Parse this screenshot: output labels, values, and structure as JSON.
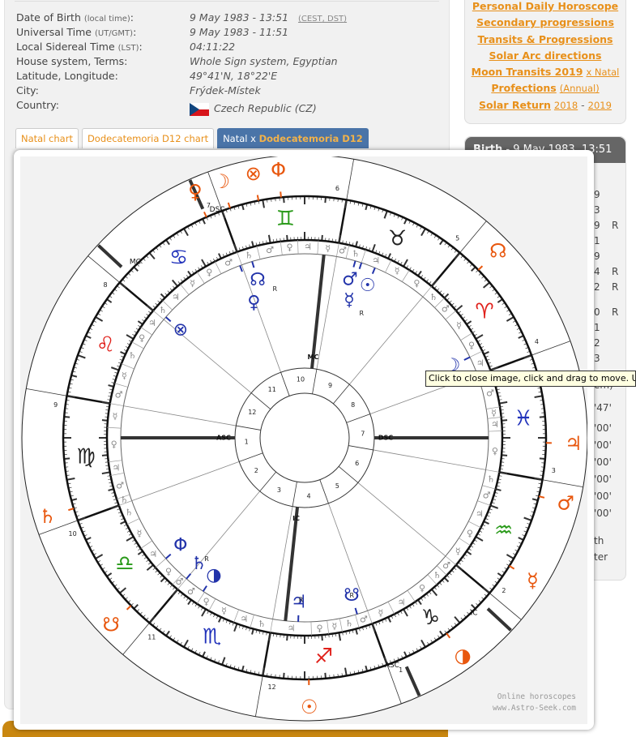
{
  "info": {
    "rows": [
      {
        "label": "Date of Birth",
        "note": "(local time)",
        "value": "9 May 1983 - 13:51",
        "links": [
          "CEST",
          "DST"
        ]
      },
      {
        "label": "Universal Time",
        "note": "(UT/GMT)",
        "value": "9 May 1983 - 11:51"
      },
      {
        "label": "Local Sidereal Time",
        "note": "(LST)",
        "value": "04:11:22"
      },
      {
        "label": "House system, Terms:",
        "value": "Whole Sign system, Egyptian"
      },
      {
        "label": "Latitude, Longitude:",
        "value": "49°41'N, 18°22'E"
      },
      {
        "label": "City:",
        "value": "Frýdek-Místek"
      },
      {
        "label": "Country:",
        "value": "Czech Republic (CZ)"
      }
    ]
  },
  "tabs": {
    "natal": "Natal chart",
    "d12": "Dodecatemoria D12 chart",
    "combo_a": "Natal x ",
    "combo_b": "Dodecatemoria D12"
  },
  "links": {
    "daily": "Personal Daily Horoscope",
    "secondary": "Secondary progressions",
    "transits": "Transits & Progressions",
    "solar_arc": "Solar Arc directions",
    "moon": "Moon Transits 2019",
    "moon_sub": "x Natal",
    "profections": "Profections",
    "profections_sub": "(Annual)",
    "solar_return": "Solar Return",
    "sr1": "2018",
    "sr_sep": "-",
    "sr2": "2019"
  },
  "birth_panel": {
    "header_bold": "Birth",
    "header_rest": " - 9 May 1983, 13:51",
    "fragments": [
      "9",
      "3",
      "9",
      "1",
      "9",
      "4",
      "2",
      "0",
      "1",
      "2",
      "3",
      "em)",
      "'47'",
      "'00'",
      "'00'",
      "'00'",
      "'00'",
      "'00'",
      "'00'",
      "th",
      "ter"
    ],
    "retro_marks": [
      "R",
      "R",
      "R",
      "R"
    ]
  },
  "tooltip": "Click to close image, click and drag to move. Use arrows",
  "credit": {
    "line1": "Online horoscopes",
    "line2": "www.Astro-Seek.com"
  },
  "chart_data": {
    "type": "astrology-biwheel",
    "inner": "Natal",
    "outer": "Dodecatemoria D12",
    "house_system": "Whole Sign",
    "terms": "Egyptian",
    "colors": {
      "fire": "#e0201a",
      "earth": "#222222",
      "air": "#2a9a1a",
      "water": "#2233bb",
      "natal": "#2233aa",
      "d12": "#e8570e"
    },
    "signs": [
      {
        "glyph": "♈",
        "el": "fire"
      },
      {
        "glyph": "♉",
        "el": "earth"
      },
      {
        "glyph": "♊",
        "el": "air"
      },
      {
        "glyph": "♋",
        "el": "water"
      },
      {
        "glyph": "♌",
        "el": "fire"
      },
      {
        "glyph": "♍",
        "el": "earth"
      },
      {
        "glyph": "♎",
        "el": "air"
      },
      {
        "glyph": "♏",
        "el": "water"
      },
      {
        "glyph": "♐",
        "el": "fire"
      },
      {
        "glyph": "♑",
        "el": "earth"
      },
      {
        "glyph": "♒",
        "el": "air"
      },
      {
        "glyph": "♓",
        "el": "water"
      }
    ],
    "egyptian_terms": [
      [
        [
          "♃",
          6
        ],
        [
          "♀",
          6
        ],
        [
          "☿",
          8
        ],
        [
          "♂",
          5
        ],
        [
          "♄",
          5
        ]
      ],
      [
        [
          "♀",
          8
        ],
        [
          "☿",
          6
        ],
        [
          "♃",
          8
        ],
        [
          "♄",
          5
        ],
        [
          "♂",
          3
        ]
      ],
      [
        [
          "☿",
          6
        ],
        [
          "♃",
          6
        ],
        [
          "♀",
          5
        ],
        [
          "♂",
          7
        ],
        [
          "♄",
          6
        ]
      ],
      [
        [
          "♂",
          7
        ],
        [
          "♀",
          6
        ],
        [
          "☿",
          6
        ],
        [
          "♃",
          7
        ],
        [
          "♄",
          4
        ]
      ],
      [
        [
          "♃",
          6
        ],
        [
          "♀",
          5
        ],
        [
          "♄",
          7
        ],
        [
          "☿",
          6
        ],
        [
          "♂",
          6
        ]
      ],
      [
        [
          "☿",
          7
        ],
        [
          "♀",
          10
        ],
        [
          "♃",
          4
        ],
        [
          "♂",
          7
        ],
        [
          "♄",
          2
        ]
      ],
      [
        [
          "♄",
          6
        ],
        [
          "☿",
          8
        ],
        [
          "♃",
          7
        ],
        [
          "♀",
          7
        ],
        [
          "♂",
          2
        ]
      ],
      [
        [
          "♂",
          7
        ],
        [
          "♀",
          4
        ],
        [
          "☿",
          8
        ],
        [
          "♃",
          5
        ],
        [
          "♄",
          6
        ]
      ],
      [
        [
          "♃",
          12
        ],
        [
          "♀",
          5
        ],
        [
          "☿",
          4
        ],
        [
          "♄",
          5
        ],
        [
          "♂",
          4
        ]
      ],
      [
        [
          "☿",
          7
        ],
        [
          "♃",
          7
        ],
        [
          "♀",
          8
        ],
        [
          "♄",
          4
        ],
        [
          "♂",
          4
        ]
      ],
      [
        [
          "☿",
          7
        ],
        [
          "♀",
          6
        ],
        [
          "♃",
          7
        ],
        [
          "♂",
          5
        ],
        [
          "♄",
          5
        ]
      ],
      [
        [
          "♀",
          12
        ],
        [
          "♃",
          4
        ],
        [
          "☿",
          3
        ],
        [
          "♂",
          9
        ],
        [
          "♄",
          2
        ]
      ]
    ],
    "natal_angles": {
      "ASC": 160,
      "MC": 64,
      "DSC": 340,
      "IC": 244
    },
    "d12_angles": {
      "ASC": 274,
      "MC": 117,
      "DSC": 94,
      "IC": 297
    },
    "natal_planets": [
      {
        "name": "Sun",
        "glyph": "☉",
        "lon": 47.5,
        "r": ""
      },
      {
        "name": "Moon",
        "glyph": "☽",
        "lon": 6,
        "r": ""
      },
      {
        "name": "Mercury",
        "glyph": "☿",
        "lon": 52,
        "r": "R"
      },
      {
        "name": "Venus",
        "glyph": "♀",
        "lon": 90.6,
        "r": ""
      },
      {
        "name": "Mars",
        "glyph": "♂",
        "lon": 54,
        "r": ""
      },
      {
        "name": "Jupiter",
        "glyph": "♃",
        "lon": 248,
        "r": "R"
      },
      {
        "name": "Saturn",
        "glyph": "♄",
        "lon": 210,
        "r": "R"
      },
      {
        "name": "North Node",
        "glyph": "☊",
        "lon": 86.6,
        "r": "R"
      },
      {
        "name": "South Node",
        "glyph": "☋",
        "lon": 266.6,
        "r": "R"
      },
      {
        "name": "Fortune",
        "glyph": "⊗",
        "lon": 119,
        "r": ""
      },
      {
        "name": "Vertex",
        "glyph": "Φ",
        "lon": 201,
        "r": ""
      },
      {
        "name": "Lilith",
        "glyph": "◑",
        "lon": 216.5,
        "r": ""
      }
    ],
    "d12_planets": [
      {
        "name": "Sun",
        "glyph": "☉",
        "lon": 251
      },
      {
        "name": "Moon",
        "glyph": "☽",
        "lon": 88
      },
      {
        "name": "Mercury",
        "glyph": "☿",
        "lon": 308
      },
      {
        "name": "Venus",
        "glyph": "♀",
        "lon": 94
      },
      {
        "name": "Mars",
        "glyph": "♂",
        "lon": 326
      },
      {
        "name": "Jupiter",
        "glyph": "♃",
        "lon": 338.8
      },
      {
        "name": "Saturn",
        "glyph": "♄",
        "lon": 177
      },
      {
        "name": "North Node",
        "glyph": "☊",
        "lon": 24
      },
      {
        "name": "South Node",
        "glyph": "☋",
        "lon": 204
      },
      {
        "name": "Fortune",
        "glyph": "⊗",
        "lon": 81
      },
      {
        "name": "Vertex",
        "glyph": "Φ",
        "lon": 75.6
      },
      {
        "name": "Lilith",
        "glyph": "◑",
        "lon": 286
      }
    ]
  }
}
